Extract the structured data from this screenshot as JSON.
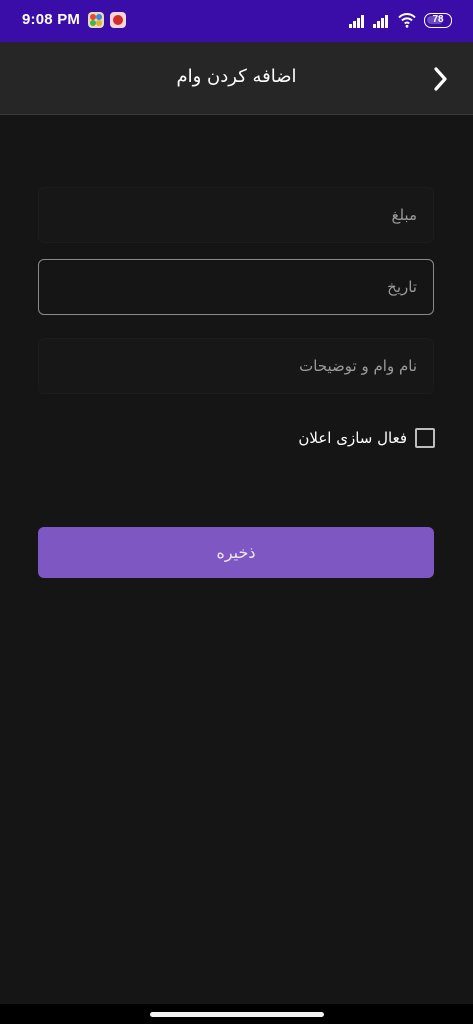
{
  "status_bar": {
    "time": "9:08 PM",
    "battery": "78",
    "icons": [
      "notification-app-icon",
      "notification-app-icon",
      "signal-icon",
      "signal-icon",
      "wifi-icon",
      "battery-icon"
    ]
  },
  "app_bar": {
    "title": "اضافه کردن وام",
    "back_icon": "chevron-right-icon"
  },
  "form": {
    "amount_placeholder": "مبلغ",
    "amount_value": "",
    "date_placeholder": "تاریخ",
    "date_value": "",
    "description_placeholder": "نام وام و توضیحات",
    "description_value": "",
    "notification_label": "فعال سازی اعلان",
    "notification_checked": false,
    "save_label": "ذخیره"
  },
  "colors": {
    "status_bar": "#3a0ca8",
    "app_bar": "#262626",
    "background": "#151515",
    "accent": "#7e57c2"
  }
}
